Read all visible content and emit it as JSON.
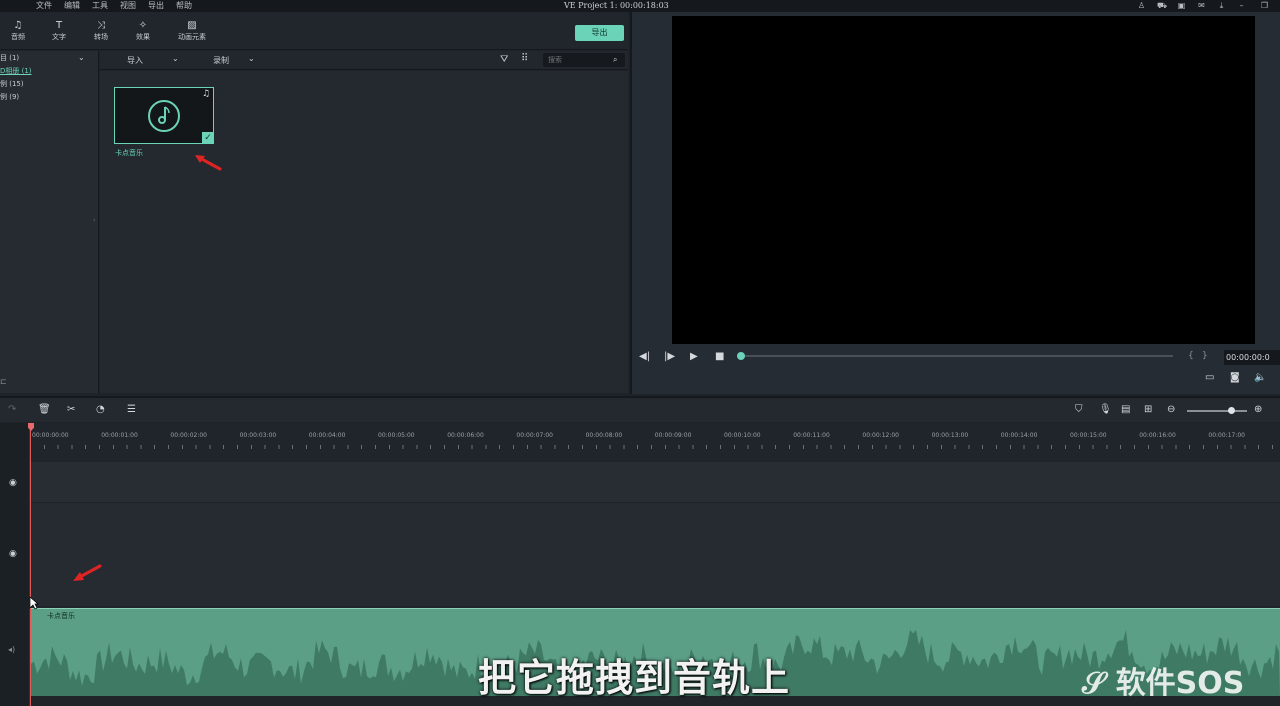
{
  "menubar": {
    "items": [
      "文件",
      "编辑",
      "工具",
      "视图",
      "导出",
      "帮助"
    ],
    "project_title": "VE Project 1:  00:00:18:03"
  },
  "toolbar": {
    "tools": [
      {
        "label": "音频",
        "icon": "music-note-icon"
      },
      {
        "label": "文字",
        "icon": "text-icon"
      },
      {
        "label": "转场",
        "icon": "transition-icon"
      },
      {
        "label": "效果",
        "icon": "effects-icon"
      },
      {
        "label": "动画元素",
        "icon": "image-icon"
      }
    ],
    "export_label": "导出"
  },
  "left_panel": {
    "categories": [
      "目 (1)",
      "D相册 (1)",
      "例 (15)",
      "例 (9)"
    ]
  },
  "filter_bar": {
    "import_label": "导入",
    "record_label": "录制",
    "search_placeholder": "搜索"
  },
  "media": {
    "item_name": "卡点音乐"
  },
  "preview": {
    "timecode": "00:00:00:0",
    "progress_fraction": 0.0
  },
  "ruler": {
    "labels": [
      "00:00:00:00",
      "00:00:01:00",
      "00:00:02:00",
      "00:00:03:00",
      "00:00:04:00",
      "00:00:05:00",
      "00:00:06:00",
      "00:00:07:00",
      "00:00:08:00",
      "00:00:09:00",
      "00:00:10:00",
      "00:00:11:00",
      "00:00:12:00",
      "00:00:13:00",
      "00:00:14:00",
      "00:00:15:00",
      "00:00:16:00",
      "00:00:17:00"
    ]
  },
  "timeline": {
    "audio_clip_name": "卡点音乐"
  },
  "subtitle": "把它拖拽到音轨上",
  "watermark": "软件SOS",
  "colors": {
    "accent": "#6bd3b7",
    "audio_clip": "#5b9f87",
    "annotation_arrow": "#e02424"
  }
}
